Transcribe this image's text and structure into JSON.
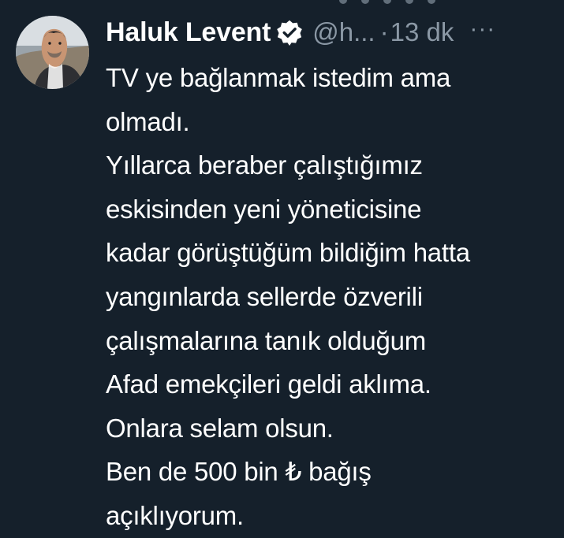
{
  "tweet": {
    "display_name": "Haluk Levent",
    "handle": "@h...",
    "separator": "·",
    "time": "13 dk",
    "more": "···",
    "verified_icon": "verified-badge-icon",
    "text_lines": [
      "TV ye bağlanmak istedim ama",
      "olmadı.",
      "Yıllarca beraber çalıştığımız",
      "eskisinden yeni yöneticisine",
      "kadar görüştüğüm bildiğim hatta",
      "yangınlarda sellerde özverili",
      "çalışmalarına tanık olduğum",
      "Afad emekçileri geldi aklıma.",
      "Onlara selam olsun.",
      "Ben de 500 bin ₺ bağış",
      "açıklıyorum."
    ]
  },
  "colors": {
    "background": "#15202b",
    "text": "#ffffff",
    "muted": "#8b98a5"
  }
}
